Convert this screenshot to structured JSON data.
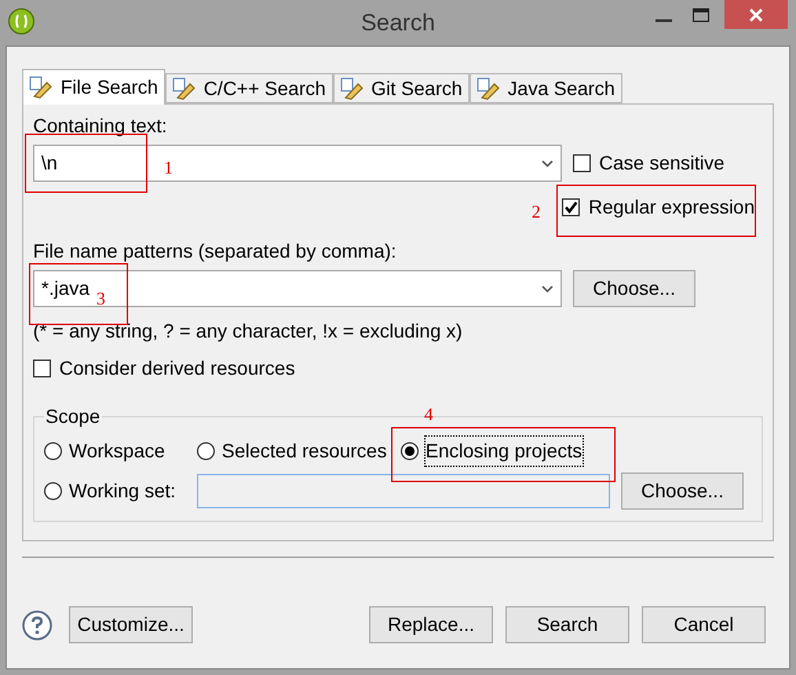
{
  "window": {
    "title": "Search"
  },
  "tabs": [
    {
      "label": "File Search",
      "selected": true
    },
    {
      "label": "C/C++ Search",
      "selected": false
    },
    {
      "label": "Git Search",
      "selected": false
    },
    {
      "label": "Java Search",
      "selected": false
    }
  ],
  "containing_text": {
    "label": "Containing text:",
    "value": "\\n"
  },
  "options": [
    {
      "label": "Case sensitive",
      "checked": false
    },
    {
      "label": "Regular expression",
      "checked": true
    }
  ],
  "file_patterns": {
    "label": "File name patterns (separated by comma):",
    "value": "*.java",
    "button": "Choose...",
    "hint": "(* = any string, ? = any character, !x = excluding x)"
  },
  "derived": {
    "label": "Consider derived resources",
    "checked": false
  },
  "scope": {
    "title": "Scope",
    "options": [
      {
        "label": "Workspace",
        "selected": false
      },
      {
        "label": "Selected resources",
        "selected": false
      },
      {
        "label": "Enclosing projects",
        "selected": true
      },
      {
        "label": "Working set:",
        "selected": false
      }
    ],
    "button": "Choose..."
  },
  "buttons": [
    {
      "label": "Customize...",
      "kind": "left"
    },
    {
      "label": "Replace...",
      "kind": "normal"
    },
    {
      "label": "Search",
      "kind": "default"
    },
    {
      "label": "Cancel",
      "kind": "normal"
    }
  ],
  "annotations": [
    {
      "number": "1"
    },
    {
      "number": "2"
    },
    {
      "number": "3"
    },
    {
      "number": "4"
    }
  ]
}
